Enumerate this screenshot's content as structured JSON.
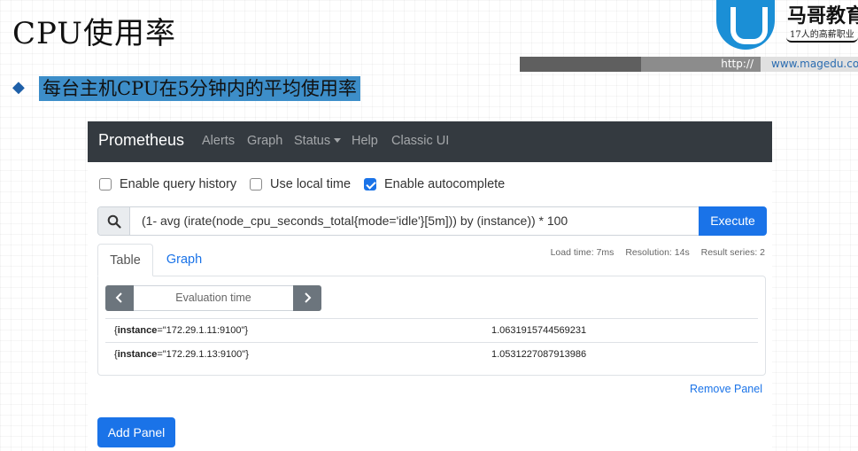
{
  "slide": {
    "title": "CPU使用率",
    "subtitle": "每台主机CPU在5分钟内的平均使用率",
    "logo": {
      "name": "马哥教育",
      "slogan": "17人的高薪职业",
      "url_prefix": "http://",
      "url": "www.magedu.com"
    }
  },
  "navbar": {
    "brand": "Prometheus",
    "items": [
      "Alerts",
      "Graph",
      "Status",
      "Help",
      "Classic UI"
    ]
  },
  "options": {
    "query_history": {
      "label": "Enable query history",
      "checked": false
    },
    "local_time": {
      "label": "Use local time",
      "checked": false
    },
    "autocomplete": {
      "label": "Enable autocomplete",
      "checked": true
    }
  },
  "query": {
    "expression": "(1- avg (irate(node_cpu_seconds_total{mode='idle'}[5m])) by (instance)) * 100",
    "execute_label": "Execute"
  },
  "tabs": {
    "table": "Table",
    "graph": "Graph"
  },
  "stats": {
    "load_time": "Load time: 7ms",
    "resolution": "Resolution: 14s",
    "result_series": "Result series: 2"
  },
  "eval_time": {
    "placeholder": "Evaluation time"
  },
  "results": [
    {
      "label_name": "instance",
      "label_value": "=\"172.29.1.11:9100\"",
      "value": "1.0631915744569231"
    },
    {
      "label_name": "instance",
      "label_value": "=\"172.29.1.13:9100\"",
      "value": "1.0531227087913986"
    }
  ],
  "panel": {
    "remove_label": "Remove Panel",
    "add_label": "Add Panel"
  },
  "colors": {
    "accent": "#1a73e8",
    "navbar": "#343a40",
    "subtitle_highlight": "#3d8ec9"
  }
}
